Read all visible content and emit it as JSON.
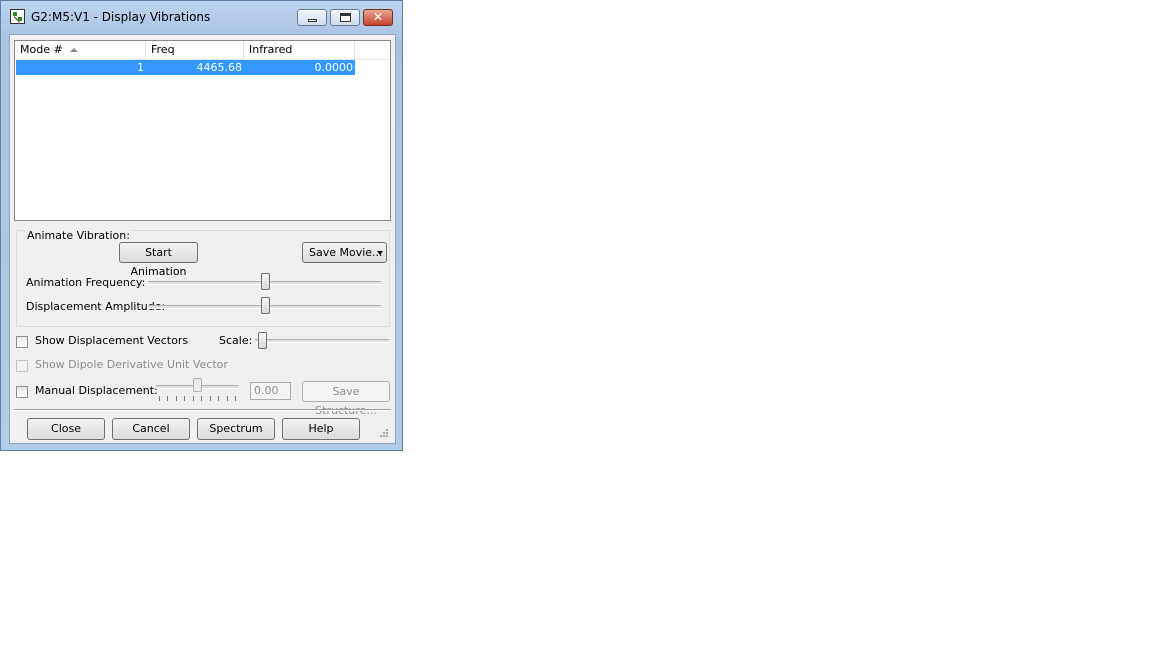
{
  "window": {
    "title": "G2:M5:V1 - Display Vibrations",
    "controls": {
      "minimize_icon": "minimize-icon",
      "maximize_icon": "restore-icon",
      "close_icon": "close-icon",
      "close_glyph": "✕"
    }
  },
  "modes_table": {
    "columns": [
      "Mode #",
      "Freq",
      "Infrared"
    ],
    "sort_column": "Mode #",
    "rows": [
      {
        "mode": "1",
        "freq": "4465.68",
        "infrared": "0.0000",
        "selected": true
      }
    ]
  },
  "animate": {
    "group_label": "Animate Vibration:",
    "start_button": "Start Animation",
    "save_movie_button": "Save Movie...",
    "frequency_label": "Animation Frequency:",
    "frequency_value": 0.5,
    "amplitude_label": "Displacement Amplitude:",
    "amplitude_value": 0.5
  },
  "options": {
    "show_vectors_label": "Show Displacement Vectors",
    "show_vectors_checked": false,
    "scale_label": "Scale:",
    "scale_value": 0.05,
    "dipole_label": "Show Dipole Derivative Unit Vector",
    "dipole_enabled": false,
    "manual_label": "Manual Displacement:",
    "manual_checked": false,
    "manual_value": "0.00",
    "save_structure_button": "Save Structure..."
  },
  "footer": {
    "close_button": "Close",
    "cancel_button": "Cancel",
    "spectrum_button": "Spectrum",
    "help_button": "Help"
  },
  "colors": {
    "selection": "#3399ff",
    "titlebar": "#bcd3ee",
    "close_button": "#c6452d"
  }
}
